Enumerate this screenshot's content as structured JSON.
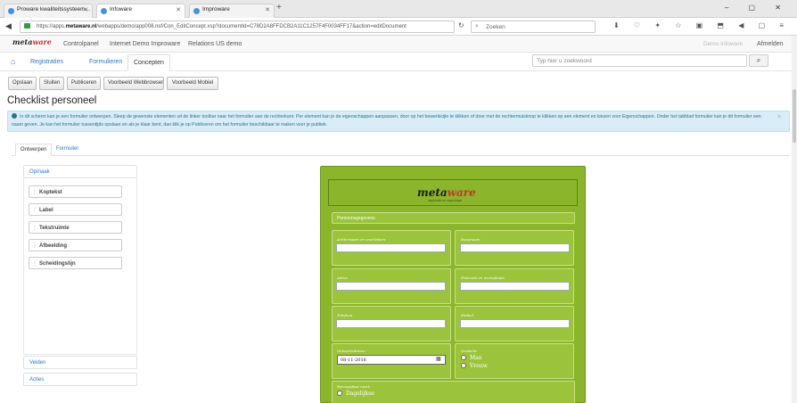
{
  "browser": {
    "tabs": [
      {
        "label": "Proware kwaliteitssysteem..."
      },
      {
        "label": "Infoware"
      },
      {
        "label": "Improware"
      }
    ],
    "new_tab_label": "+",
    "url_prefix": "https://apps.",
    "url_domain": "metaware.nl",
    "url_rest": "/webapps/demo/app008.nsf/Con_EditConcept.xsp?documentId=C78D2A8FFDCB2A11C1257F4F0034FF17&action=editDocument",
    "search_placeholder": "Zoeken",
    "window_controls": "–  ▢  ✕",
    "toolbar_icons": "⬇ ♡ ✦ ☆ ▣ ⬒ ◀ ▢ ≡"
  },
  "appnav": {
    "logo_main": "meta",
    "logo_accent": "ware",
    "links": [
      "Controlpanel",
      "Internet Demo Improware",
      "Relations US demo"
    ],
    "user": "Demo Infoware",
    "logout": "Afmelden"
  },
  "subnav": {
    "tabs": [
      "Registraties",
      "Formulieren",
      "Concepten"
    ],
    "active_tab": "Concepten",
    "search_placeholder": "Typ hier u zoekwoord"
  },
  "actions": [
    "Opslaan",
    "Sluiten",
    "Publiceren",
    "Voorbeeld Webbrowser",
    "Voorbeeld Mobiel"
  ],
  "page_title": "Checklist personeel",
  "info_text": "In dit scherm kan je een formulier ontwerpen. Sleep de gewenste elementen uit de linker toolbar naar het formulier aan de rechterkant. Per element kan je de eigenschappen aanpassen, door op het bewerkicijle te klikken of door met de rechtermuisknop te klikken op een element en kiezen voor Eigenschappen. Onder het tabblad formulier kan je dit formulier een naam geven. Je kan het formulier tussentijds opslaan en als je klaar bent, dan klik je op Publiceren om het formulier beschikbaar te maken voor je publiek.",
  "inner_tabs": [
    "Ontwerpen",
    "Formulier"
  ],
  "left_panel": {
    "group_title": "Opmaak",
    "elements": [
      "Koptekst",
      "Label",
      "Tekstruimte",
      "Afbeelding",
      "Scheidingslijn"
    ],
    "section_fields": "Velden",
    "section_actions": "Acties"
  },
  "form": {
    "logo_main": "meta",
    "logo_accent": "ware",
    "logo_sub": "registratie en rapportage",
    "section_title": "Persoonsgegevens",
    "fields": {
      "achternaam": "Achternaam en voorletters",
      "roepnaam": "Roepnaam",
      "adres": "Adres",
      "postcode": "Postcode en woonplaats",
      "telefoon": "Telefoon",
      "mobiel": "Mobiel",
      "geboortedatum": "Geboortedatum",
      "geslacht": "Geslacht"
    },
    "date_value": "08-11-2016",
    "gender_options": [
      "Man",
      "Vrouw"
    ],
    "bottom_label": "Beroepsfase moet:",
    "bottom_option": "Dagelijkse"
  }
}
